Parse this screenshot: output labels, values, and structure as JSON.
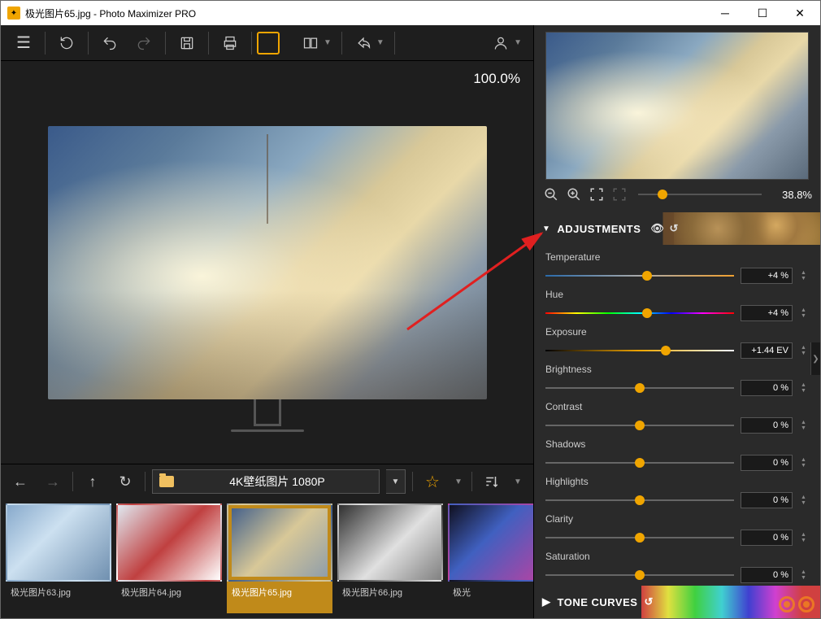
{
  "titlebar": {
    "filename": "极光图片65.jpg",
    "separator": " - ",
    "appname": "Photo Maximizer PRO"
  },
  "canvas": {
    "zoom": "100.0%"
  },
  "preview": {
    "zoom": "38.8%"
  },
  "filmstrip": {
    "path": "4K壁纸图片 1080P",
    "thumbs": [
      {
        "label": "极光图片63.jpg",
        "cls": "t1"
      },
      {
        "label": "极光图片64.jpg",
        "cls": "t2"
      },
      {
        "label": "极光图片65.jpg",
        "cls": "t3",
        "selected": true
      },
      {
        "label": "极光图片66.jpg",
        "cls": "t4"
      },
      {
        "label": "极光",
        "cls": "t5"
      }
    ]
  },
  "panels": {
    "adjustments": "ADJUSTMENTS",
    "tonecurves": "TONE CURVES"
  },
  "adjustments": [
    {
      "label": "Temperature",
      "value": "+4 %",
      "pos": 54,
      "track": "temp"
    },
    {
      "label": "Hue",
      "value": "+4 %",
      "pos": 54,
      "track": "hue"
    },
    {
      "label": "Exposure",
      "value": "+1.44 EV",
      "pos": 64,
      "track": "expo"
    },
    {
      "label": "Brightness",
      "value": "0 %",
      "pos": 50,
      "track": ""
    },
    {
      "label": "Contrast",
      "value": "0 %",
      "pos": 50,
      "track": ""
    },
    {
      "label": "Shadows",
      "value": "0 %",
      "pos": 50,
      "track": ""
    },
    {
      "label": "Highlights",
      "value": "0 %",
      "pos": 50,
      "track": ""
    },
    {
      "label": "Clarity",
      "value": "0 %",
      "pos": 50,
      "track": ""
    },
    {
      "label": "Saturation",
      "value": "0 %",
      "pos": 50,
      "track": ""
    }
  ]
}
